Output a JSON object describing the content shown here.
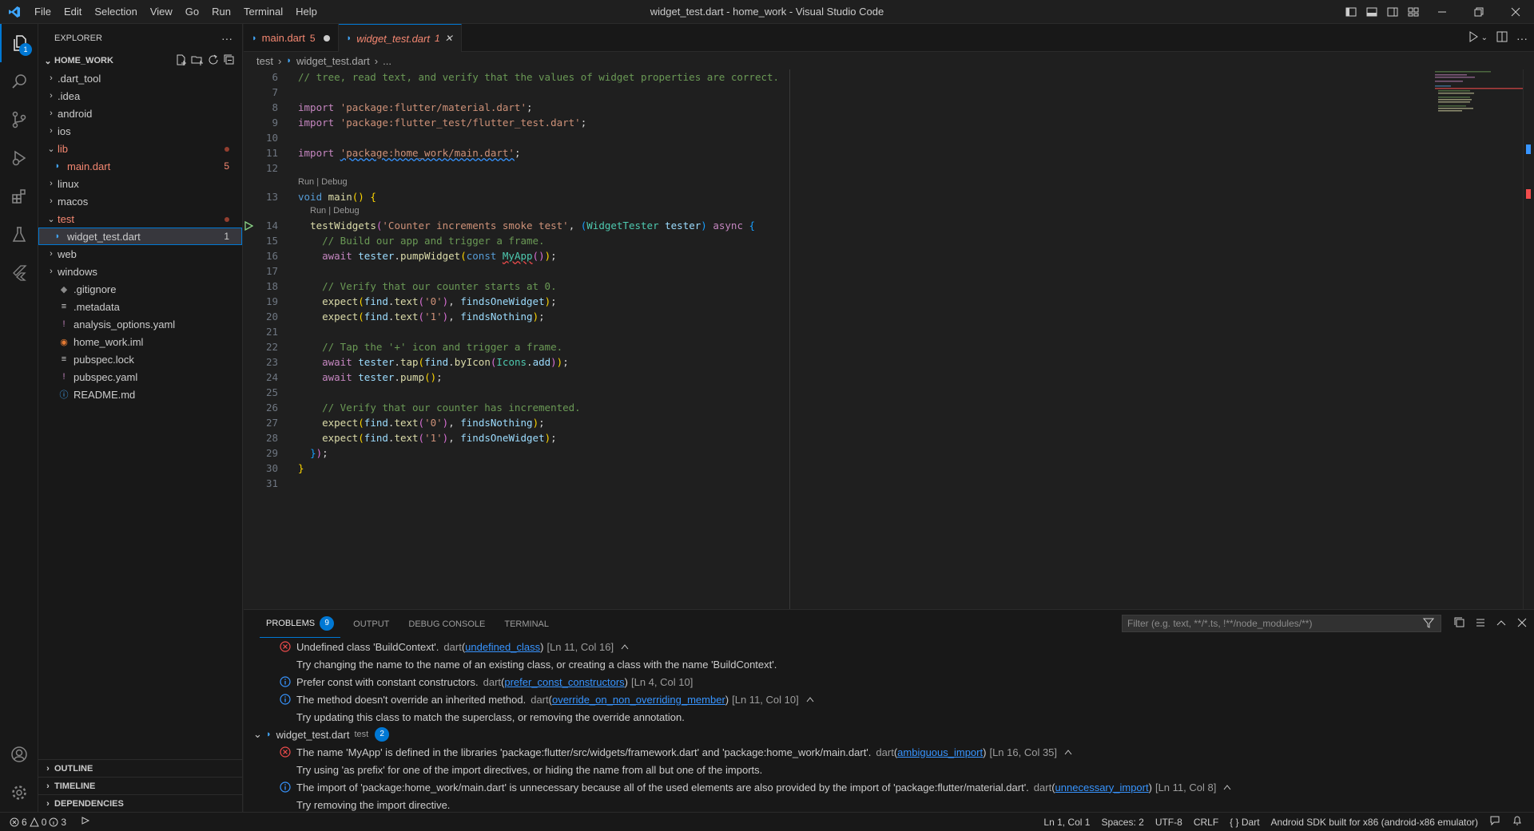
{
  "window": {
    "title": "widget_test.dart - home_work - Visual Studio Code",
    "menu": [
      "File",
      "Edit",
      "Selection",
      "View",
      "Go",
      "Run",
      "Terminal",
      "Help"
    ]
  },
  "activity": {
    "explorer_badge": "1"
  },
  "sidebar": {
    "header": "EXPLORER",
    "root": "HOME_WORK",
    "items": [
      {
        "label": ".dart_tool",
        "type": "folder",
        "open": false,
        "depth": 1
      },
      {
        "label": ".idea",
        "type": "folder",
        "open": false,
        "depth": 1
      },
      {
        "label": "android",
        "type": "folder",
        "open": false,
        "depth": 1
      },
      {
        "label": "ios",
        "type": "folder",
        "open": false,
        "depth": 1
      },
      {
        "label": "lib",
        "type": "folder",
        "open": true,
        "depth": 1,
        "error": true
      },
      {
        "label": "main.dart",
        "type": "dart",
        "depth": 2,
        "error": true,
        "count": "5"
      },
      {
        "label": "linux",
        "type": "folder",
        "open": false,
        "depth": 1
      },
      {
        "label": "macos",
        "type": "folder",
        "open": false,
        "depth": 1
      },
      {
        "label": "test",
        "type": "folder",
        "open": true,
        "depth": 1,
        "error": true
      },
      {
        "label": "widget_test.dart",
        "type": "dart",
        "depth": 2,
        "count": "1",
        "selected": true
      },
      {
        "label": "web",
        "type": "folder",
        "open": false,
        "depth": 1
      },
      {
        "label": "windows",
        "type": "folder",
        "open": false,
        "depth": 1
      },
      {
        "label": ".gitignore",
        "type": "git",
        "depth": 1
      },
      {
        "label": ".metadata",
        "type": "meta",
        "depth": 1
      },
      {
        "label": "analysis_options.yaml",
        "type": "yaml",
        "depth": 1
      },
      {
        "label": "home_work.iml",
        "type": "iml",
        "depth": 1
      },
      {
        "label": "pubspec.lock",
        "type": "lock",
        "depth": 1
      },
      {
        "label": "pubspec.yaml",
        "type": "yaml",
        "depth": 1
      },
      {
        "label": "README.md",
        "type": "info",
        "depth": 1
      }
    ],
    "sections": [
      "OUTLINE",
      "TIMELINE",
      "DEPENDENCIES"
    ]
  },
  "tabs": [
    {
      "label": "main.dart",
      "count": "5",
      "modified": true,
      "active": false
    },
    {
      "label": "widget_test.dart",
      "count": "1",
      "active": true
    }
  ],
  "breadcrumb": [
    "test",
    "widget_test.dart",
    "..."
  ],
  "code": {
    "lens": "Run | Debug",
    "lines": [
      {
        "n": "6",
        "tokens": [
          [
            "c-com",
            "// tree, read text, and verify that the values of widget properties are correct."
          ]
        ]
      },
      {
        "n": "7",
        "tokens": []
      },
      {
        "n": "8",
        "tokens": [
          [
            "c-kw2",
            "import "
          ],
          [
            "c-str",
            "'package:flutter/material.dart'"
          ],
          [
            "c-pl",
            ";"
          ]
        ]
      },
      {
        "n": "9",
        "tokens": [
          [
            "c-kw2",
            "import "
          ],
          [
            "c-str",
            "'package:flutter_test/flutter_test.dart'"
          ],
          [
            "c-pl",
            ";"
          ]
        ]
      },
      {
        "n": "10",
        "tokens": []
      },
      {
        "n": "11",
        "tokens": [
          [
            "c-kw2",
            "import "
          ],
          [
            "c-str squig-i",
            "'package:home_work/main.dart'"
          ],
          [
            "c-pl",
            ";"
          ]
        ]
      },
      {
        "n": "12",
        "tokens": []
      },
      {
        "lens": "Run | Debug",
        "indent": 0
      },
      {
        "n": "13",
        "tokens": [
          [
            "c-kw",
            "void "
          ],
          [
            "c-fn",
            "main"
          ],
          [
            "c-br",
            "()"
          ],
          [
            "c-pl",
            " "
          ],
          [
            "c-br",
            "{"
          ]
        ]
      },
      {
        "lens": "Run | Debug",
        "indent": 2
      },
      {
        "n": "14",
        "run": true,
        "tokens": [
          [
            "c-pl",
            "  "
          ],
          [
            "c-fn",
            "testWidgets"
          ],
          [
            "c-br2",
            "("
          ],
          [
            "c-str",
            "'Counter increments smoke test'"
          ],
          [
            "c-pl",
            ", "
          ],
          [
            "c-br3",
            "("
          ],
          [
            "c-cls",
            "WidgetTester"
          ],
          [
            "c-pl",
            " "
          ],
          [
            "c-var",
            "tester"
          ],
          [
            "c-br3",
            ")"
          ],
          [
            "c-pl",
            " "
          ],
          [
            "c-kw2",
            "async"
          ],
          [
            "c-pl",
            " "
          ],
          [
            "c-br3",
            "{"
          ]
        ]
      },
      {
        "n": "15",
        "tokens": [
          [
            "c-pl",
            "    "
          ],
          [
            "c-com",
            "// Build our app and trigger a frame."
          ]
        ]
      },
      {
        "n": "16",
        "tokens": [
          [
            "c-pl",
            "    "
          ],
          [
            "c-kw2",
            "await "
          ],
          [
            "c-var",
            "tester"
          ],
          [
            "c-pl",
            "."
          ],
          [
            "c-fn",
            "pumpWidget"
          ],
          [
            "c-br",
            "("
          ],
          [
            "c-kw",
            "const "
          ],
          [
            "c-cls squig",
            "MyApp"
          ],
          [
            "c-br2",
            "()"
          ],
          [
            "c-br",
            ")"
          ],
          [
            "c-pl",
            ";"
          ]
        ]
      },
      {
        "n": "17",
        "tokens": []
      },
      {
        "n": "18",
        "tokens": [
          [
            "c-pl",
            "    "
          ],
          [
            "c-com",
            "// Verify that our counter starts at 0."
          ]
        ]
      },
      {
        "n": "19",
        "tokens": [
          [
            "c-pl",
            "    "
          ],
          [
            "c-fn",
            "expect"
          ],
          [
            "c-br",
            "("
          ],
          [
            "c-var",
            "find"
          ],
          [
            "c-pl",
            "."
          ],
          [
            "c-fn",
            "text"
          ],
          [
            "c-br2",
            "("
          ],
          [
            "c-str",
            "'0'"
          ],
          [
            "c-br2",
            ")"
          ],
          [
            "c-pl",
            ", "
          ],
          [
            "c-var",
            "findsOneWidget"
          ],
          [
            "c-br",
            ")"
          ],
          [
            "c-pl",
            ";"
          ]
        ]
      },
      {
        "n": "20",
        "tokens": [
          [
            "c-pl",
            "    "
          ],
          [
            "c-fn",
            "expect"
          ],
          [
            "c-br",
            "("
          ],
          [
            "c-var",
            "find"
          ],
          [
            "c-pl",
            "."
          ],
          [
            "c-fn",
            "text"
          ],
          [
            "c-br2",
            "("
          ],
          [
            "c-str",
            "'1'"
          ],
          [
            "c-br2",
            ")"
          ],
          [
            "c-pl",
            ", "
          ],
          [
            "c-var",
            "findsNothing"
          ],
          [
            "c-br",
            ")"
          ],
          [
            "c-pl",
            ";"
          ]
        ]
      },
      {
        "n": "21",
        "tokens": []
      },
      {
        "n": "22",
        "tokens": [
          [
            "c-pl",
            "    "
          ],
          [
            "c-com",
            "// Tap the '+' icon and trigger a frame."
          ]
        ]
      },
      {
        "n": "23",
        "tokens": [
          [
            "c-pl",
            "    "
          ],
          [
            "c-kw2",
            "await "
          ],
          [
            "c-var",
            "tester"
          ],
          [
            "c-pl",
            "."
          ],
          [
            "c-fn",
            "tap"
          ],
          [
            "c-br",
            "("
          ],
          [
            "c-var",
            "find"
          ],
          [
            "c-pl",
            "."
          ],
          [
            "c-fn",
            "byIcon"
          ],
          [
            "c-br2",
            "("
          ],
          [
            "c-cls",
            "Icons"
          ],
          [
            "c-pl",
            "."
          ],
          [
            "c-var",
            "add"
          ],
          [
            "c-br2",
            ")"
          ],
          [
            "c-br",
            ")"
          ],
          [
            "c-pl",
            ";"
          ]
        ]
      },
      {
        "n": "24",
        "tokens": [
          [
            "c-pl",
            "    "
          ],
          [
            "c-kw2",
            "await "
          ],
          [
            "c-var",
            "tester"
          ],
          [
            "c-pl",
            "."
          ],
          [
            "c-fn",
            "pump"
          ],
          [
            "c-br",
            "()"
          ],
          [
            "c-pl",
            ";"
          ]
        ]
      },
      {
        "n": "25",
        "tokens": []
      },
      {
        "n": "26",
        "tokens": [
          [
            "c-pl",
            "    "
          ],
          [
            "c-com",
            "// Verify that our counter has incremented."
          ]
        ]
      },
      {
        "n": "27",
        "tokens": [
          [
            "c-pl",
            "    "
          ],
          [
            "c-fn",
            "expect"
          ],
          [
            "c-br",
            "("
          ],
          [
            "c-var",
            "find"
          ],
          [
            "c-pl",
            "."
          ],
          [
            "c-fn",
            "text"
          ],
          [
            "c-br2",
            "("
          ],
          [
            "c-str",
            "'0'"
          ],
          [
            "c-br2",
            ")"
          ],
          [
            "c-pl",
            ", "
          ],
          [
            "c-var",
            "findsNothing"
          ],
          [
            "c-br",
            ")"
          ],
          [
            "c-pl",
            ";"
          ]
        ]
      },
      {
        "n": "28",
        "tokens": [
          [
            "c-pl",
            "    "
          ],
          [
            "c-fn",
            "expect"
          ],
          [
            "c-br",
            "("
          ],
          [
            "c-var",
            "find"
          ],
          [
            "c-pl",
            "."
          ],
          [
            "c-fn",
            "text"
          ],
          [
            "c-br2",
            "("
          ],
          [
            "c-str",
            "'1'"
          ],
          [
            "c-br2",
            ")"
          ],
          [
            "c-pl",
            ", "
          ],
          [
            "c-var",
            "findsOneWidget"
          ],
          [
            "c-br",
            ")"
          ],
          [
            "c-pl",
            ";"
          ]
        ]
      },
      {
        "n": "29",
        "tokens": [
          [
            "c-pl",
            "  "
          ],
          [
            "c-br3",
            "}"
          ],
          [
            "c-br2",
            ")"
          ],
          [
            "c-pl",
            ";"
          ]
        ]
      },
      {
        "n": "30",
        "tokens": [
          [
            "c-br",
            "}"
          ]
        ]
      },
      {
        "n": "31",
        "tokens": []
      }
    ]
  },
  "panel": {
    "tabs": [
      {
        "label": "PROBLEMS",
        "badge": "9",
        "active": true
      },
      {
        "label": "OUTPUT"
      },
      {
        "label": "DEBUG CONSOLE"
      },
      {
        "label": "TERMINAL"
      }
    ],
    "filter_placeholder": "Filter (e.g. text, **/*.ts, !**/node_modules/**)",
    "rows": [
      {
        "kind": "problem",
        "sev": "error",
        "msg": "Undefined class 'BuildContext'.",
        "src": "dart",
        "code": "undefined_class",
        "pos": "[Ln 11, Col 16]",
        "expand": true
      },
      {
        "kind": "hint",
        "msg": "Try changing the name to the name of an existing class, or creating a class with the name 'BuildContext'."
      },
      {
        "kind": "problem",
        "sev": "info",
        "msg": "Prefer const with constant constructors.",
        "src": "dart",
        "code": "prefer_const_constructors",
        "pos": "[Ln 4, Col 10]"
      },
      {
        "kind": "problem",
        "sev": "info",
        "msg": "The method doesn't override an inherited method.",
        "src": "dart",
        "code": "override_on_non_overriding_member",
        "pos": "[Ln 11, Col 10]",
        "expand": true
      },
      {
        "kind": "hint",
        "msg": "Try updating this class to match the superclass, or removing the override annotation."
      },
      {
        "kind": "file",
        "name": "widget_test.dart",
        "folder": "test",
        "count": "2"
      },
      {
        "kind": "problem",
        "sev": "error",
        "msg": "The name 'MyApp' is defined in the libraries 'package:flutter/src/widgets/framework.dart' and 'package:home_work/main.dart'.",
        "src": "dart",
        "code": "ambiguous_import",
        "pos": "[Ln 16, Col 35]",
        "expand": true
      },
      {
        "kind": "hint",
        "msg": "Try using 'as prefix' for one of the import directives, or hiding the name from all but one of the imports."
      },
      {
        "kind": "problem",
        "sev": "info",
        "msg": "The import of 'package:home_work/main.dart' is unnecessary because all of the used elements are also provided by the import of 'package:flutter/material.dart'.",
        "src": "dart",
        "code": "unnecessary_import",
        "pos": "[Ln 11, Col 8]",
        "expand": true
      },
      {
        "kind": "hint",
        "msg": "Try removing the import directive."
      }
    ]
  },
  "status": {
    "errors": "6",
    "warnings": "0",
    "infos": "3",
    "position": "Ln 1, Col 1",
    "spaces": "Spaces: 2",
    "encoding": "UTF-8",
    "eol": "CRLF",
    "language": "Dart",
    "device": "Android SDK built for x86 (android-x86 emulator)"
  }
}
